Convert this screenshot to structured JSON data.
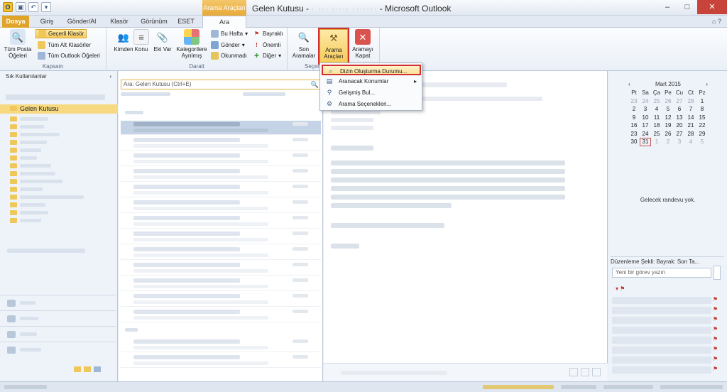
{
  "titlebar": {
    "title_prefix": "Gelen Kutusu -",
    "title_blur": "·  ··· ·····  ·······",
    "title_suffix": "- Microsoft Outlook",
    "context_tab_header": "Arama Araçları",
    "minimize": "–",
    "maximize": "□",
    "close": "✕"
  },
  "tabs": {
    "file": "Dosya",
    "home": "Giriş",
    "send_receive": "Gönder/Al",
    "folder": "Klasör",
    "view": "Görünüm",
    "eset": "ESET",
    "search": "Ara",
    "right_icons": "⌂ ?"
  },
  "ribbon": {
    "scope": {
      "all_mail": "Tüm Posta Öğeleri",
      "current_folder": "Geçerli Klasör",
      "subfolders": "Tüm Alt Klasörler",
      "all_items": "Tüm Outlook Öğeleri",
      "label": "Kapsam"
    },
    "refine": {
      "from": "Kimden",
      "subject": "Konu",
      "attachments": "Eki Var",
      "categories": "Kategorilere Ayrılmış",
      "this_week": "Bu Hafta",
      "sent_to": "Gönder",
      "unread": "Okunmadı",
      "flagged": "Bayraklı",
      "important": "Önemli",
      "more": "Diğer",
      "label": "Daralt"
    },
    "options": {
      "recent": "Son Aramalar",
      "tools": "Arama Araçları",
      "close": "Aramayı Kapat",
      "label": "Seçen"
    }
  },
  "nav": {
    "favorites": "Sık Kullanılanlar",
    "inbox": "Gelen Kutusu"
  },
  "list": {
    "search_placeholder": "Ara: Gelen Kutusu (Ctrl+E)"
  },
  "dropdown": {
    "items": [
      "Dizin Oluşturma Durumu...",
      "Aranacak Konumlar",
      "Gelişmiş Bul...",
      "Arama Seçenekleri..."
    ]
  },
  "todo": {
    "month": "Mart 2015",
    "dow": [
      "Pt",
      "Sa",
      "Ça",
      "Pe",
      "Cu",
      "Ct",
      "Pz"
    ],
    "weeks": [
      [
        "23",
        "24",
        "25",
        "26",
        "27",
        "28",
        "1"
      ],
      [
        "2",
        "3",
        "4",
        "5",
        "6",
        "7",
        "8"
      ],
      [
        "9",
        "10",
        "11",
        "12",
        "13",
        "14",
        "15"
      ],
      [
        "16",
        "17",
        "18",
        "19",
        "20",
        "21",
        "22"
      ],
      [
        "23",
        "24",
        "25",
        "26",
        "27",
        "28",
        "29"
      ],
      [
        "30",
        "31",
        "1",
        "2",
        "3",
        "4",
        "5"
      ]
    ],
    "no_appointments": "Gelecek randevu yok.",
    "arrange": "Düzenleme Şekli: Bayrak: Son Ta...",
    "new_task": "Yeni bir görev yazın"
  }
}
